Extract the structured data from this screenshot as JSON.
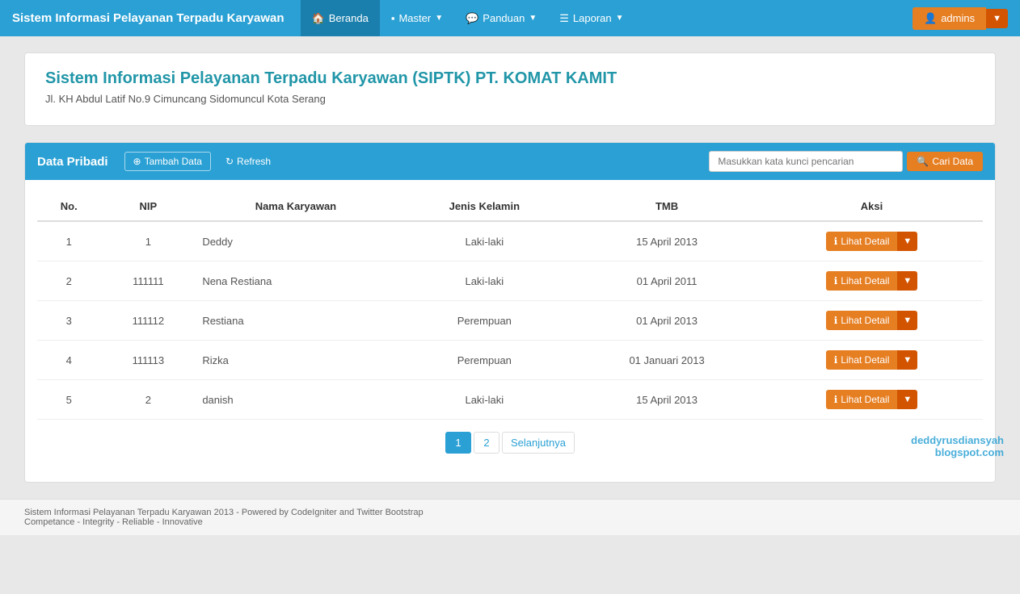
{
  "navbar": {
    "brand": "Sistem Informasi Pelayanan Terpadu Karyawan",
    "items": [
      {
        "label": "Beranda",
        "icon": "🏠",
        "active": true,
        "hasDropdown": false
      },
      {
        "label": "Master",
        "icon": "⊞",
        "active": false,
        "hasDropdown": true
      },
      {
        "label": "Panduan",
        "icon": "💬",
        "active": false,
        "hasDropdown": true
      },
      {
        "label": "Laporan",
        "icon": "☰",
        "active": false,
        "hasDropdown": true
      }
    ],
    "user": "admins"
  },
  "header": {
    "title": "Sistem Informasi Pelayanan Terpadu Karyawan (SIPTK) PT. KOMAT KAMIT",
    "address": "Jl. KH Abdul Latif No.9 Cimuncang Sidomuncul Kota Serang"
  },
  "panel": {
    "title": "Data Pribadi",
    "btn_tambah": "Tambah Data",
    "btn_refresh": "Refresh",
    "search_placeholder": "Masukkan kata kunci pencarian",
    "btn_cari": "Cari Data"
  },
  "table": {
    "columns": [
      "No.",
      "NIP",
      "Nama Karyawan",
      "Jenis Kelamin",
      "TMB",
      "Aksi"
    ],
    "rows": [
      {
        "no": "1",
        "nip": "1",
        "nama": "Deddy",
        "jenis_kelamin": "Laki-laki",
        "tmb": "15 April 2013"
      },
      {
        "no": "2",
        "nip": "111111",
        "nama": "Nena Restiana",
        "jenis_kelamin": "Laki-laki",
        "tmb": "01 April 2011"
      },
      {
        "no": "3",
        "nip": "111112",
        "nama": "Restiana",
        "jenis_kelamin": "Perempuan",
        "tmb": "01 April 2013"
      },
      {
        "no": "4",
        "nip": "111113",
        "nama": "Rizka",
        "jenis_kelamin": "Perempuan",
        "tmb": "01 Januari 2013"
      },
      {
        "no": "5",
        "nip": "2",
        "nama": "danish",
        "jenis_kelamin": "Laki-laki",
        "tmb": "15 April 2013"
      }
    ],
    "btn_lihat": "Lihat Detail"
  },
  "pagination": {
    "pages": [
      "1",
      "2"
    ],
    "next_label": "Selanjutnya",
    "active_page": "1"
  },
  "footer": {
    "line1": "Sistem Informasi Pelayanan Terpadu Karyawan 2013 - Powered by CodeIgniter and Twitter Bootstrap",
    "line2": "Competance - Integrity - Reliable - Innovative"
  },
  "watermark": {
    "line1": "deddyrusdiansyah",
    "line2": "blogspot.com"
  }
}
